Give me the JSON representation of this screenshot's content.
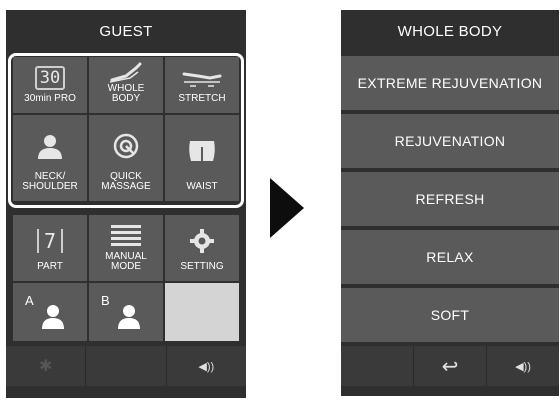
{
  "left_screen": {
    "title": "GUEST",
    "favorites": [
      {
        "label": "30min PRO",
        "icon": "30min-icon",
        "icon_text": "30"
      },
      {
        "label": "WHOLE\nBODY",
        "icon": "whole-body-icon"
      },
      {
        "label": "STRETCH",
        "icon": "stretch-icon"
      },
      {
        "label": "NECK/\nSHOULDER",
        "icon": "neck-shoulder-icon"
      },
      {
        "label": "QUICK\nMASSAGE",
        "icon": "quick-massage-icon"
      },
      {
        "label": "WAIST",
        "icon": "waist-icon"
      }
    ],
    "tools": [
      {
        "label": "PART",
        "icon": "part-icon",
        "icon_text": "7"
      },
      {
        "label": "MANUAL\nMODE",
        "icon": "manual-mode-icon"
      },
      {
        "label": "SETTING",
        "icon": "gear-icon"
      }
    ],
    "users": [
      {
        "letter": "A",
        "icon": "user-icon"
      },
      {
        "letter": "B",
        "icon": "user-icon"
      }
    ],
    "bottom_bar": [
      {
        "icon": "bluetooth-icon",
        "glyph": "✱"
      },
      {
        "icon": "blank",
        "glyph": ""
      },
      {
        "icon": "speaker-icon",
        "glyph": "◀))"
      }
    ]
  },
  "right_screen": {
    "title": "WHOLE BODY",
    "items": [
      {
        "label": "EXTREME REJUVENATION"
      },
      {
        "label": "REJUVENATION"
      },
      {
        "label": "REFRESH"
      },
      {
        "label": "RELAX"
      },
      {
        "label": "SOFT"
      }
    ],
    "bottom_bar": [
      {
        "icon": "blank",
        "glyph": ""
      },
      {
        "icon": "back-icon",
        "glyph": "↩"
      },
      {
        "icon": "speaker-icon",
        "glyph": "◀))"
      }
    ]
  },
  "colors": {
    "panel_bg": "#2f2f2f",
    "tile_bg": "#5a5a5a",
    "tile_empty": "#d4d4d4",
    "frame": "#ffffff",
    "arrow": "#0d0d0d"
  }
}
